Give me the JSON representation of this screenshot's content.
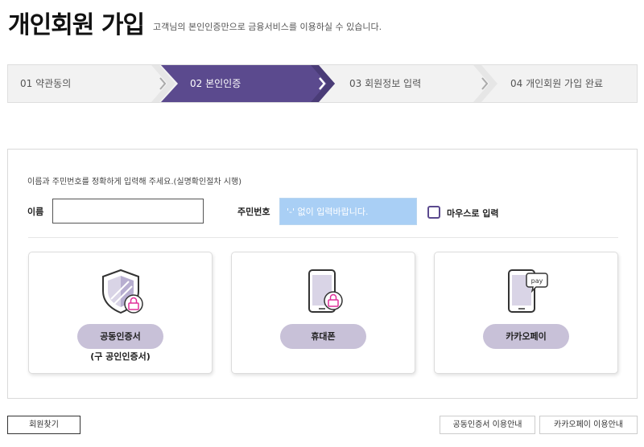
{
  "header": {
    "title": "개인회원 가입",
    "subtitle": "고객님의 본인인증만으로 금융서비스를 이용하실 수 있습니다."
  },
  "steps": [
    {
      "label": "01  약관동의",
      "active": false
    },
    {
      "label": "02  본인인증",
      "active": true
    },
    {
      "label": "03  회원정보 입력",
      "active": false
    },
    {
      "label": "04  개인회원 가입 완료",
      "active": false
    }
  ],
  "verify": {
    "notice": "이름과 주민번호를 정확하게 입력해 주세요.(실명확인절차 시행)",
    "name_label": "이름",
    "name_value": "",
    "rrn_label": "주민번호",
    "rrn_placeholder": "'-' 없이 입력바랍니다.",
    "mouse_input_label": "마우스로 입력",
    "mouse_input_checked": false
  },
  "methods": [
    {
      "label": "공동인증서",
      "sub": "(구 공인인증서)",
      "icon": "shield-lock-icon"
    },
    {
      "label": "휴대폰",
      "sub": "",
      "icon": "phone-lock-icon"
    },
    {
      "label": "카카오페이",
      "sub": "",
      "icon": "phone-pay-icon"
    }
  ],
  "footer": {
    "find_member": "회원찾기",
    "cert_guide": "공동인증서 이용안내",
    "kakao_guide": "카카오페이 이용안내"
  },
  "colors": {
    "active_step": "#5b4a8e",
    "pill": "#c8c1d8",
    "rrn_bg": "#a9cff5",
    "accent_pink": "#e0309a"
  }
}
